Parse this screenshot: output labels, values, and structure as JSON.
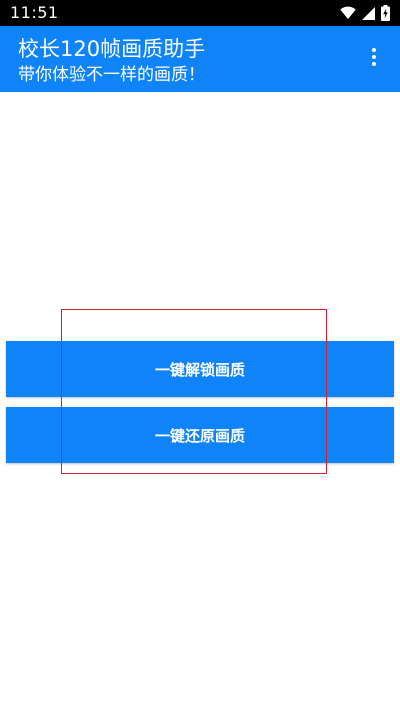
{
  "status_bar": {
    "time": "11:51",
    "icons": [
      "wifi-icon",
      "signal-icon",
      "battery-charging-icon"
    ]
  },
  "app_bar": {
    "title": "校长120帧画质助手",
    "subtitle": "带你体验不一样的画质！",
    "menu_icon": "more-vert-icon",
    "background_color": "#0f84f9"
  },
  "actions": {
    "unlock_label": "一键解锁画质",
    "restore_label": "一键还原画质",
    "button_color": "#0f84f9"
  },
  "annotation": {
    "highlight_color": "#d0202e"
  }
}
